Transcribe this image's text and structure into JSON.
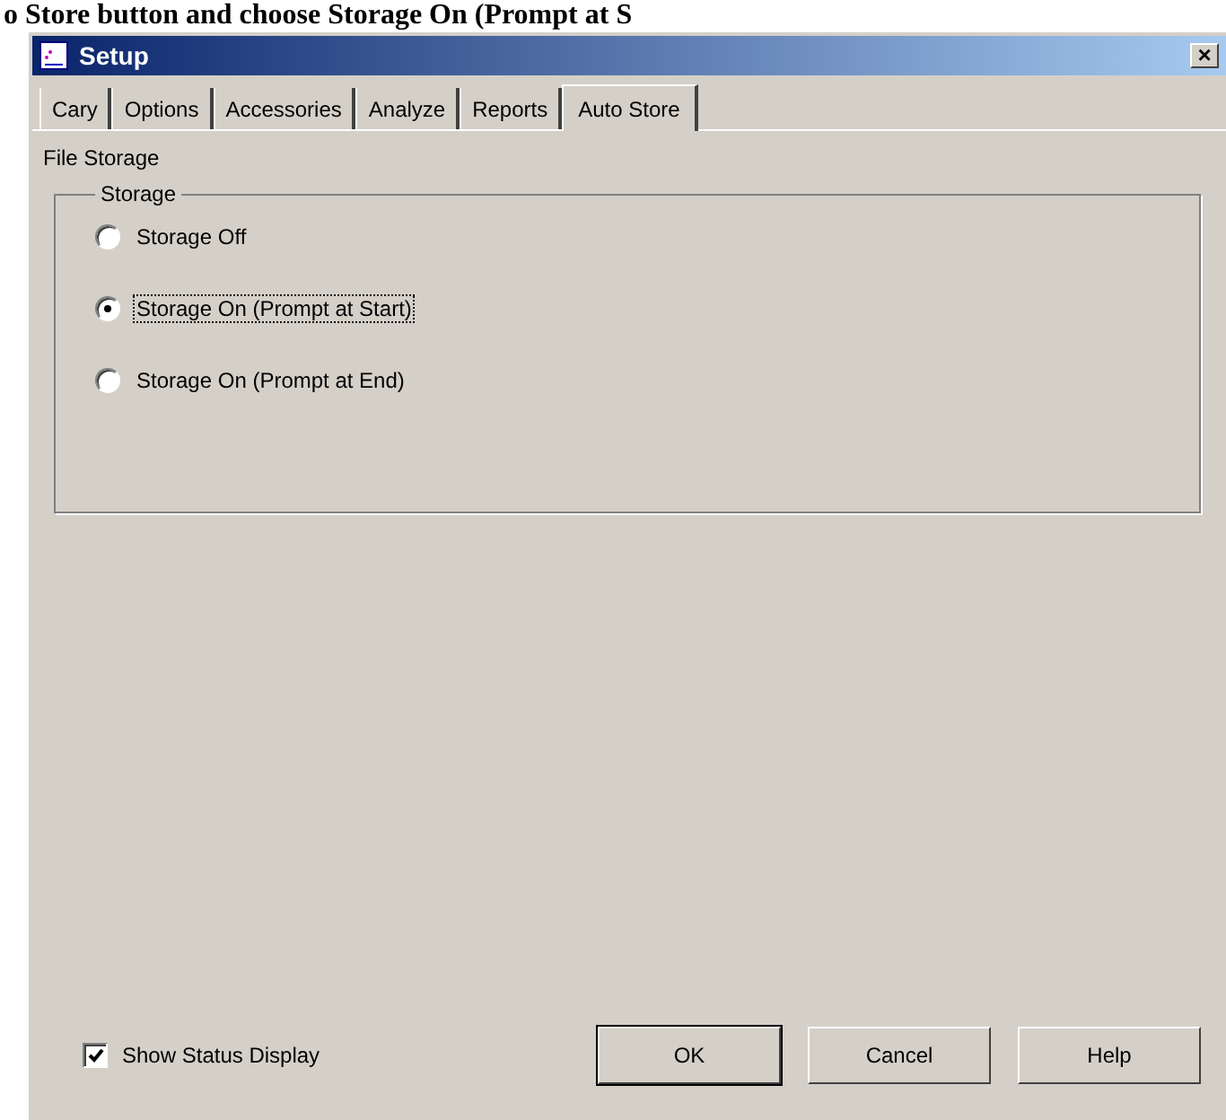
{
  "document_heading": "o Store button and choose Storage On (Prompt at S",
  "window": {
    "title": "Setup",
    "close": "×"
  },
  "tabs": [
    {
      "label": "Cary",
      "selected": false
    },
    {
      "label": "Options",
      "selected": false
    },
    {
      "label": "Accessories",
      "selected": false
    },
    {
      "label": "Analyze",
      "selected": false
    },
    {
      "label": "Reports",
      "selected": false
    },
    {
      "label": "Auto Store",
      "selected": true
    }
  ],
  "section_label": "File Storage",
  "group": {
    "title": "Storage",
    "options": [
      {
        "label": "Storage Off",
        "selected": false
      },
      {
        "label": "Storage On (Prompt at Start)",
        "selected": true
      },
      {
        "label": "Storage On (Prompt at End)",
        "selected": false
      }
    ]
  },
  "show_status": {
    "label": "Show Status Display",
    "checked": true
  },
  "buttons": [
    {
      "label": "OK",
      "default": true
    },
    {
      "label": "Cancel",
      "default": false
    },
    {
      "label": "Help",
      "default": false
    }
  ]
}
